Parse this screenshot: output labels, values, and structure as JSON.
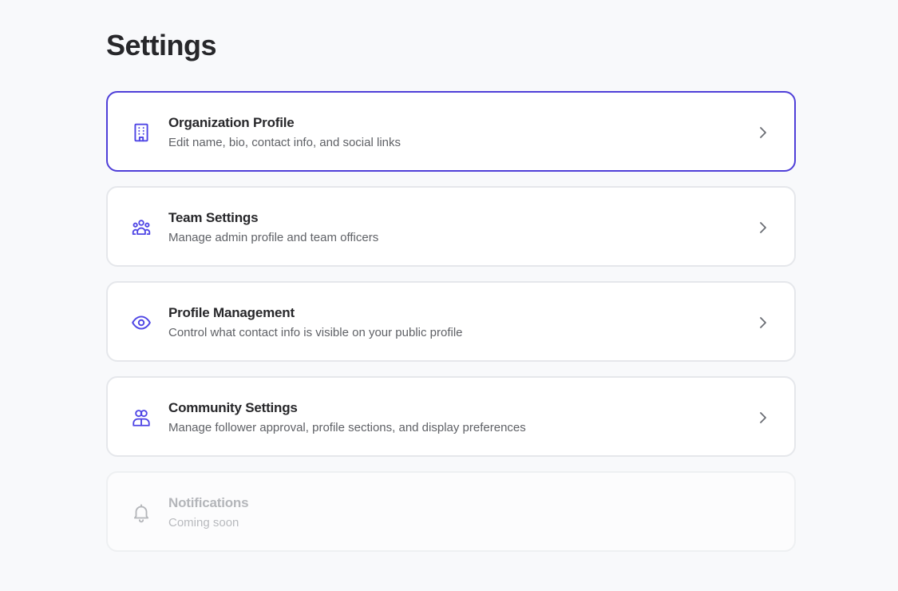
{
  "header": {
    "title": "Settings"
  },
  "colors": {
    "accent": "#4f3fd8",
    "icon_active": "#4f46e5",
    "icon_disabled": "#b4b6ba",
    "card_border": "#e5e7eb",
    "background": "#f8f9fb"
  },
  "cards": [
    {
      "title": "Organization Profile",
      "description": "Edit name, bio, contact info, and social links",
      "icon": "building-icon",
      "active": true,
      "disabled": false
    },
    {
      "title": "Team Settings",
      "description": "Manage admin profile and team officers",
      "icon": "users-group-icon",
      "active": false,
      "disabled": false
    },
    {
      "title": "Profile Management",
      "description": "Control what contact info is visible on your public profile",
      "icon": "eye-icon",
      "active": false,
      "disabled": false
    },
    {
      "title": "Community Settings",
      "description": "Manage follower approval, profile sections, and display preferences",
      "icon": "community-icon",
      "active": false,
      "disabled": false
    },
    {
      "title": "Notifications",
      "description": "Coming soon",
      "icon": "bell-icon",
      "active": false,
      "disabled": true
    }
  ]
}
